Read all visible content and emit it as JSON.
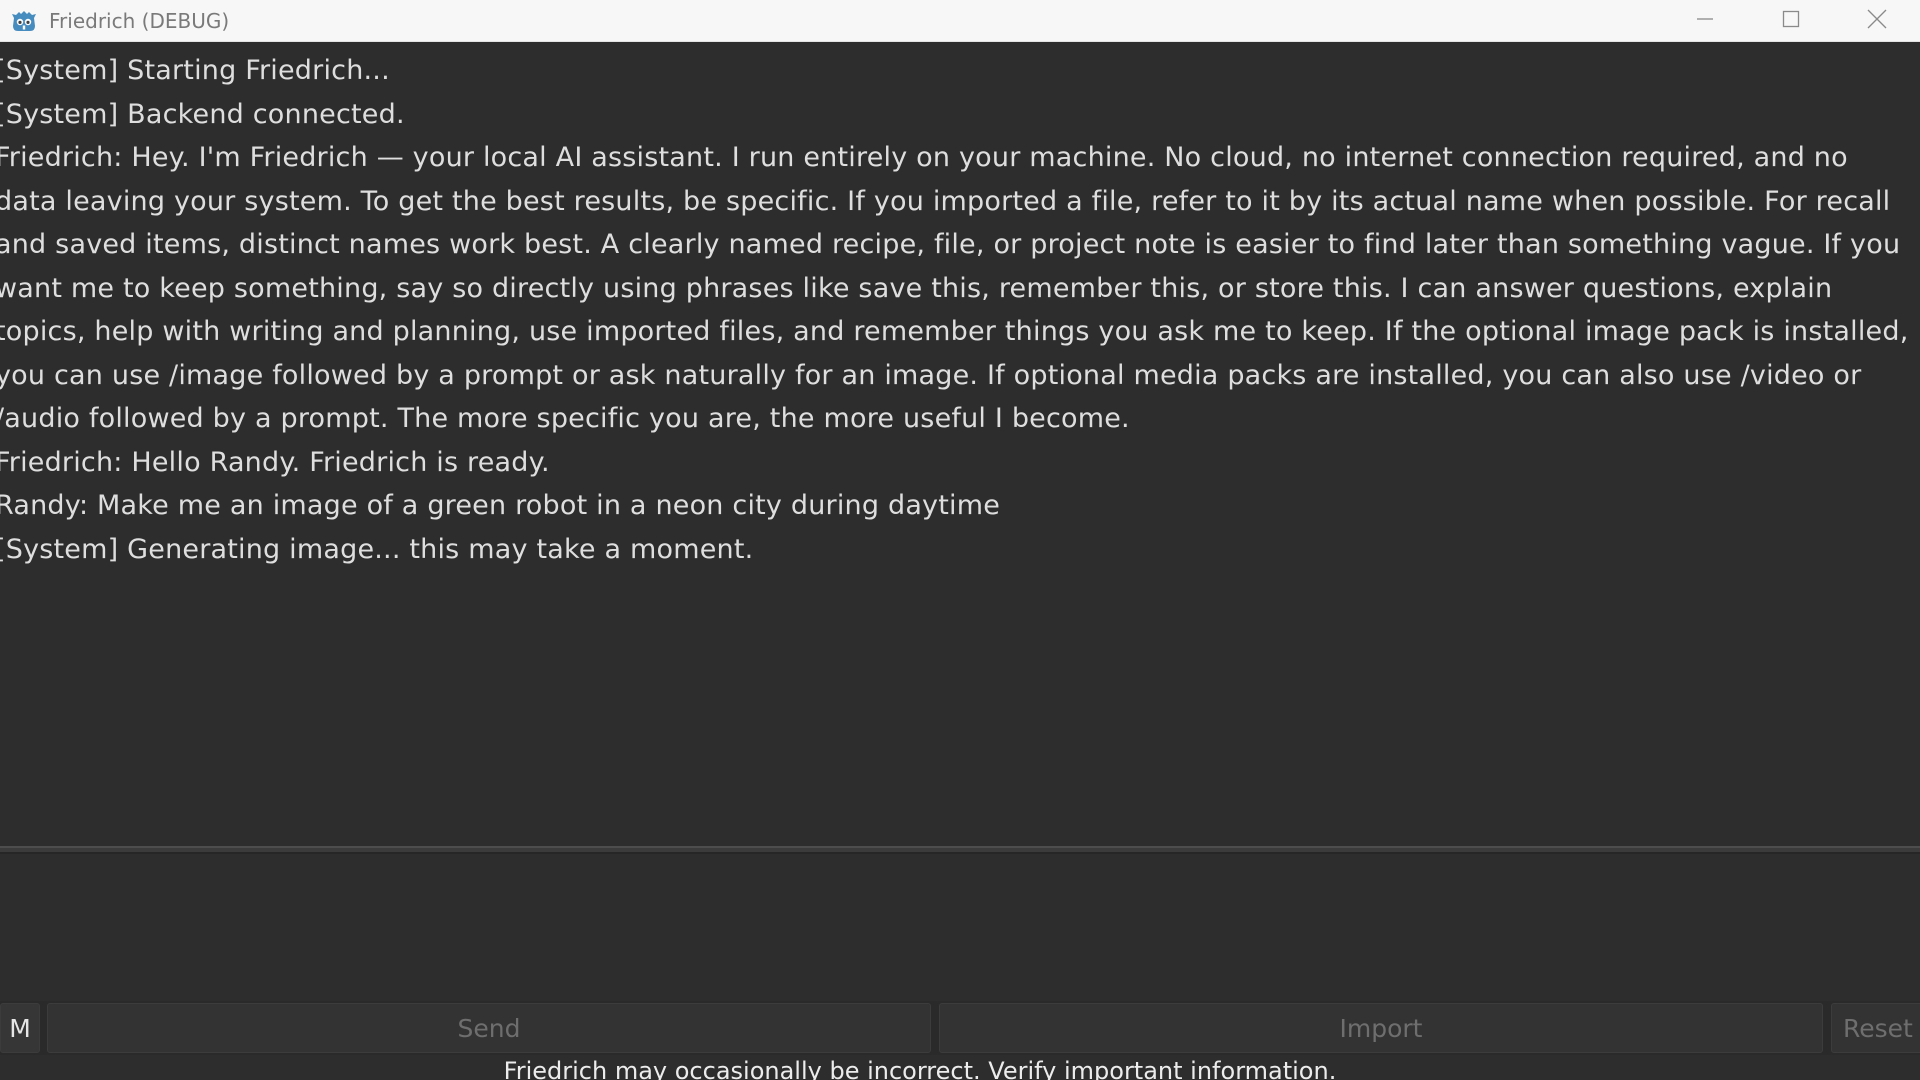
{
  "window": {
    "title": "Friedrich (DEBUG)",
    "icon": "godot-robot-icon",
    "controls": [
      "minimize-icon",
      "maximize-icon",
      "close-icon"
    ]
  },
  "chat": {
    "lines": [
      "[System] Starting Friedrich...",
      "[System] Backend connected.",
      "Friedrich: Hey. I'm Friedrich — your local AI assistant. I run entirely on your machine. No cloud, no internet connection required, and no data leaving your system. To get the best results, be specific. If you imported a file, refer to it by its actual name when possible. For recall and saved items, distinct names work best. A clearly named recipe, file, or project note is easier to find later than something vague. If you want me to keep something, say so directly using phrases like save this, remember this, or store this. I can answer questions, explain topics, help with writing and planning, use imported files, and remember things you ask me to keep. If the optional image pack is installed, you can use /image followed by a prompt or ask naturally for an image. If optional media packs are installed, you can also use /video or /audio followed by a prompt. The more specific you are, the more useful I become.",
      "Friedrich: Hello Randy. Friedrich is ready.",
      "Randy: Make me an image of a green robot in a neon city during daytime",
      "[System] Generating image... this may take a moment."
    ]
  },
  "input": {
    "value": "",
    "placeholder": ""
  },
  "toolbar": {
    "m_label": "M",
    "send_label": "Send",
    "import_label": "Import",
    "reset_label": "Reset"
  },
  "footer": {
    "disclaimer": "Friedrich may occasionally be incorrect. Verify important information."
  },
  "colors": {
    "background": "#2d2d2d",
    "text": "#dedede",
    "titlebar": "#f7f7f7",
    "button": "#333333",
    "button_text_disabled": "#6e6e6e",
    "icon_accent": "#478cbf"
  }
}
